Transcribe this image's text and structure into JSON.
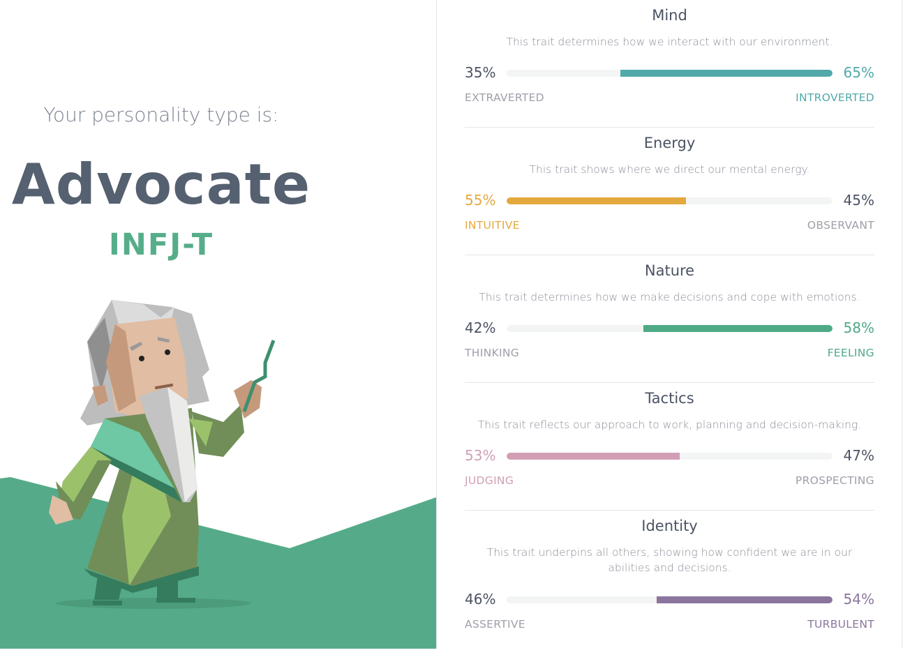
{
  "result": {
    "intro": "Your personality type is:",
    "type_name": "Advocate",
    "type_code": "INFJ-T",
    "accent": "#56ad8a"
  },
  "traits": [
    {
      "title": "Mind",
      "description": "This trait determines how we interact with our environment.",
      "left_pct": "35%",
      "right_pct": "65%",
      "left_label": "EXTRAVERTED",
      "right_label": "INTROVERTED",
      "dominant": "right",
      "value": 65,
      "color": "#51a9aa"
    },
    {
      "title": "Energy",
      "description": "This trait shows where we direct our mental energy.",
      "left_pct": "55%",
      "right_pct": "45%",
      "left_label": "INTUITIVE",
      "right_label": "OBSERVANT",
      "dominant": "left",
      "value": 55,
      "color": "#e3a93f"
    },
    {
      "title": "Nature",
      "description": "This trait determines how we make decisions and cope with emotions.",
      "left_pct": "42%",
      "right_pct": "58%",
      "left_label": "THINKING",
      "right_label": "FEELING",
      "dominant": "right",
      "value": 58,
      "color": "#4faa86"
    },
    {
      "title": "Tactics",
      "description": "This trait reflects our approach to work, planning and decision-making.",
      "left_pct": "53%",
      "right_pct": "47%",
      "left_label": "JUDGING",
      "right_label": "PROSPECTING",
      "dominant": "left",
      "value": 53,
      "color": "#d19eb5"
    },
    {
      "title": "Identity",
      "description": "This trait underpins all others, showing how confident we are in our abilities and decisions.",
      "left_pct": "46%",
      "right_pct": "54%",
      "left_label": "ASSERTIVE",
      "right_label": "TURBULENT",
      "dominant": "right",
      "value": 54,
      "color": "#8a759d"
    }
  ]
}
